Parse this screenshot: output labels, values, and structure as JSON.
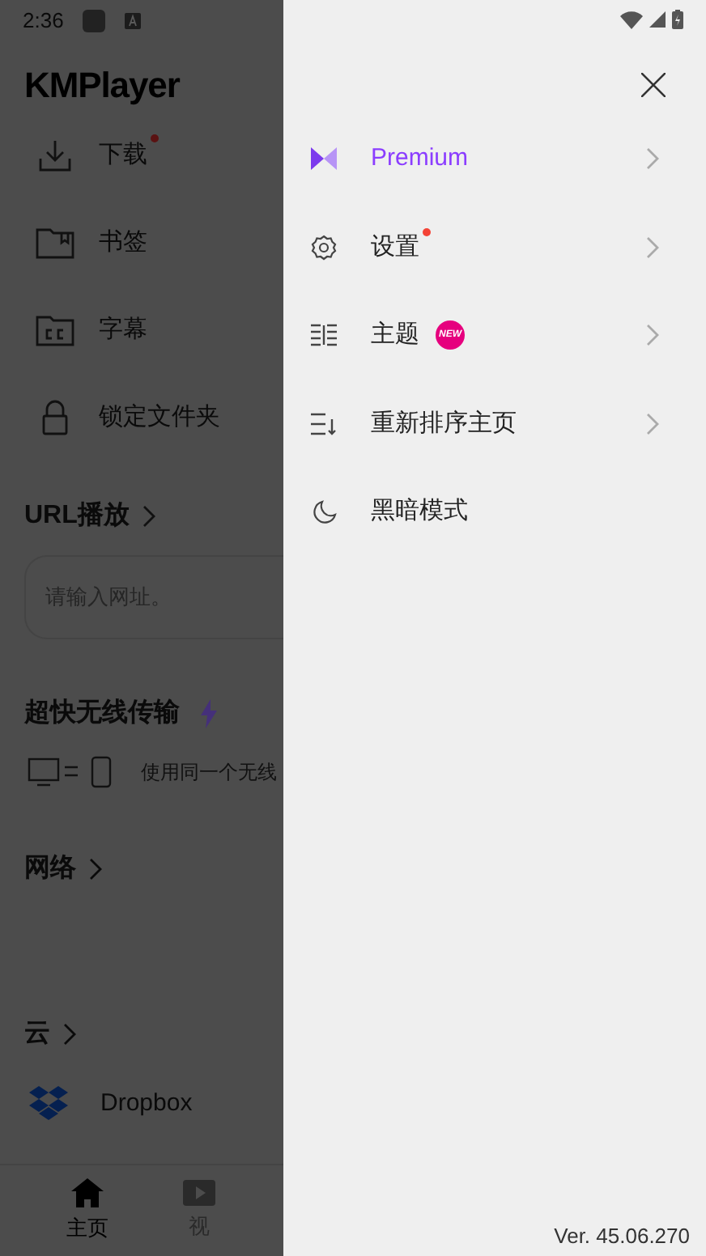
{
  "status_bar": {
    "time": "2:36"
  },
  "app": {
    "title": "KMPlayer",
    "quick_items": [
      {
        "kind": "download",
        "label": "下载",
        "dot": true
      },
      {
        "kind": "bookmark",
        "label": "书签",
        "dot": false
      },
      {
        "kind": "subtitle",
        "label": "字幕",
        "dot": false
      },
      {
        "kind": "lock",
        "label": "锁定文件夹",
        "dot": false
      }
    ],
    "url_section": {
      "title": "URL播放",
      "placeholder": "请输入网址。"
    },
    "transfer": {
      "title": "超快无线传输",
      "hint": "使用同一个无线"
    },
    "network": {
      "title": "网络"
    },
    "cloud": {
      "title": "云",
      "items": [
        {
          "label": "Dropbox"
        }
      ]
    },
    "bottom_nav": [
      {
        "kind": "home",
        "label": "主页",
        "selected": true
      },
      {
        "kind": "video",
        "label": "视",
        "selected": false
      }
    ]
  },
  "drawer": {
    "items": [
      {
        "kind": "premium",
        "label": "Premium",
        "dot": false,
        "chevron": true
      },
      {
        "kind": "settings",
        "label": "设置",
        "dot": true,
        "chevron": true
      },
      {
        "kind": "theme",
        "label": "主题",
        "badge": "NEW",
        "dot": false,
        "chevron": true
      },
      {
        "kind": "reorder",
        "label": "重新排序主页",
        "dot": false,
        "chevron": true
      },
      {
        "kind": "darkmode",
        "label": "黑暗模式",
        "dot": false,
        "chevron": false
      }
    ],
    "version": "Ver. 45.06.270"
  }
}
